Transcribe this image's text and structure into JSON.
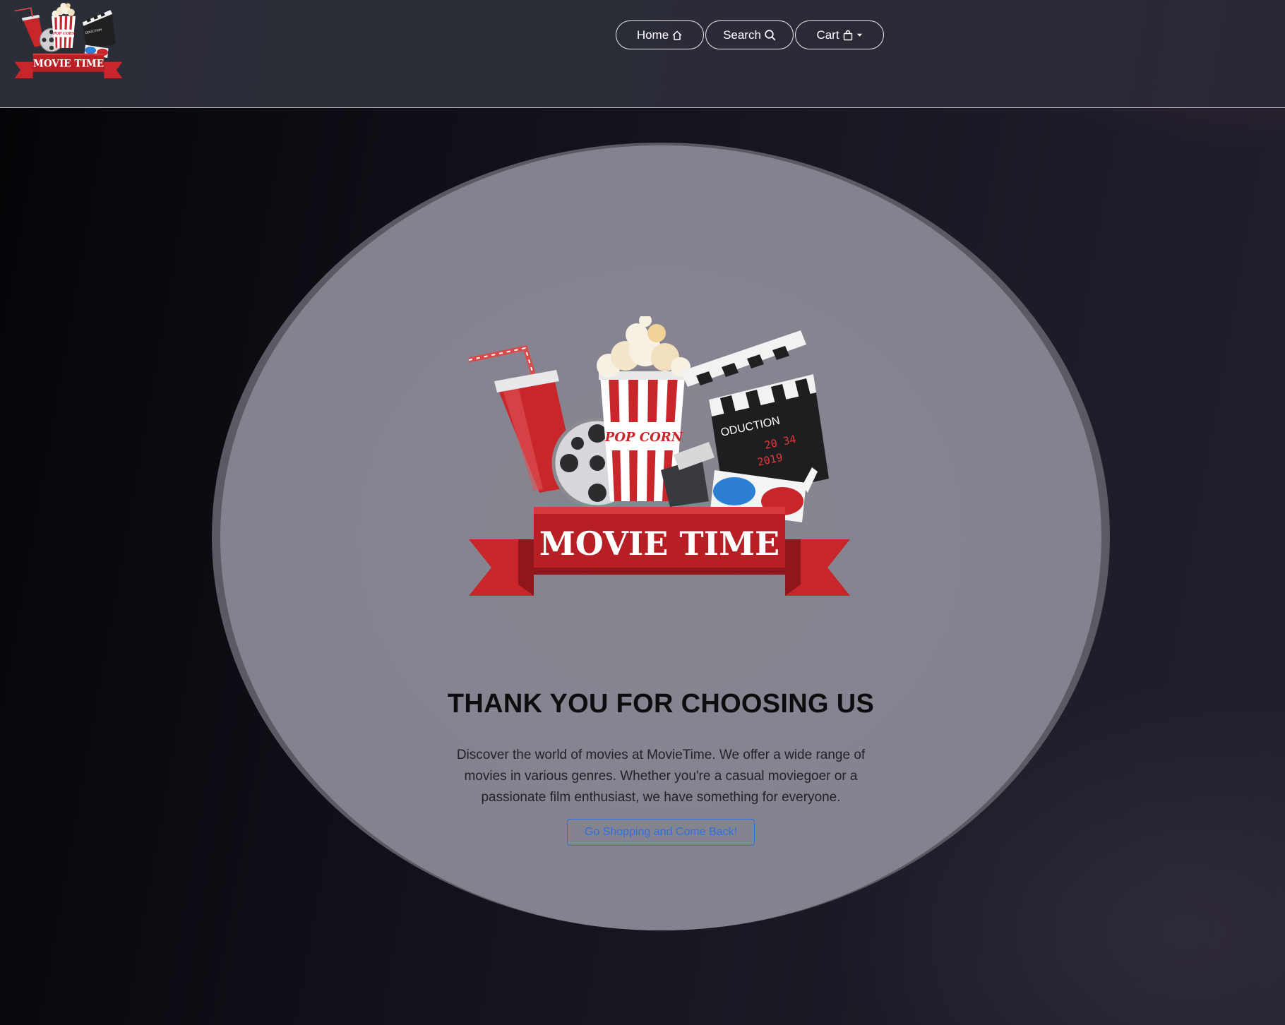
{
  "header": {
    "logo_text": "MOVIE TIME",
    "nav": {
      "home_label": "Home",
      "home_icon": "house-icon",
      "search_label": "Search",
      "search_icon": "search-icon",
      "cart_label": "Cart",
      "cart_icon": "bag-icon",
      "cart_dropdown_icon": "caret-down-icon"
    }
  },
  "hero": {
    "logo_text": "MOVIE TIME",
    "logo_popcorn_text": "POP CORN",
    "logo_clapper_text": "ODUCTION",
    "title": "THANK YOU FOR CHOOSING US",
    "description": "Discover the world of movies at MovieTime. We offer a wide range of movies in various genres. Whether you're a casual moviegoer or a passionate film enthusiast, we have something for everyone.",
    "cta_label": "Go Shopping and Come Back!"
  },
  "colors": {
    "accent_red": "#c8262b",
    "link_blue": "#2f6fe0",
    "header_bg": "#2b2d37"
  }
}
